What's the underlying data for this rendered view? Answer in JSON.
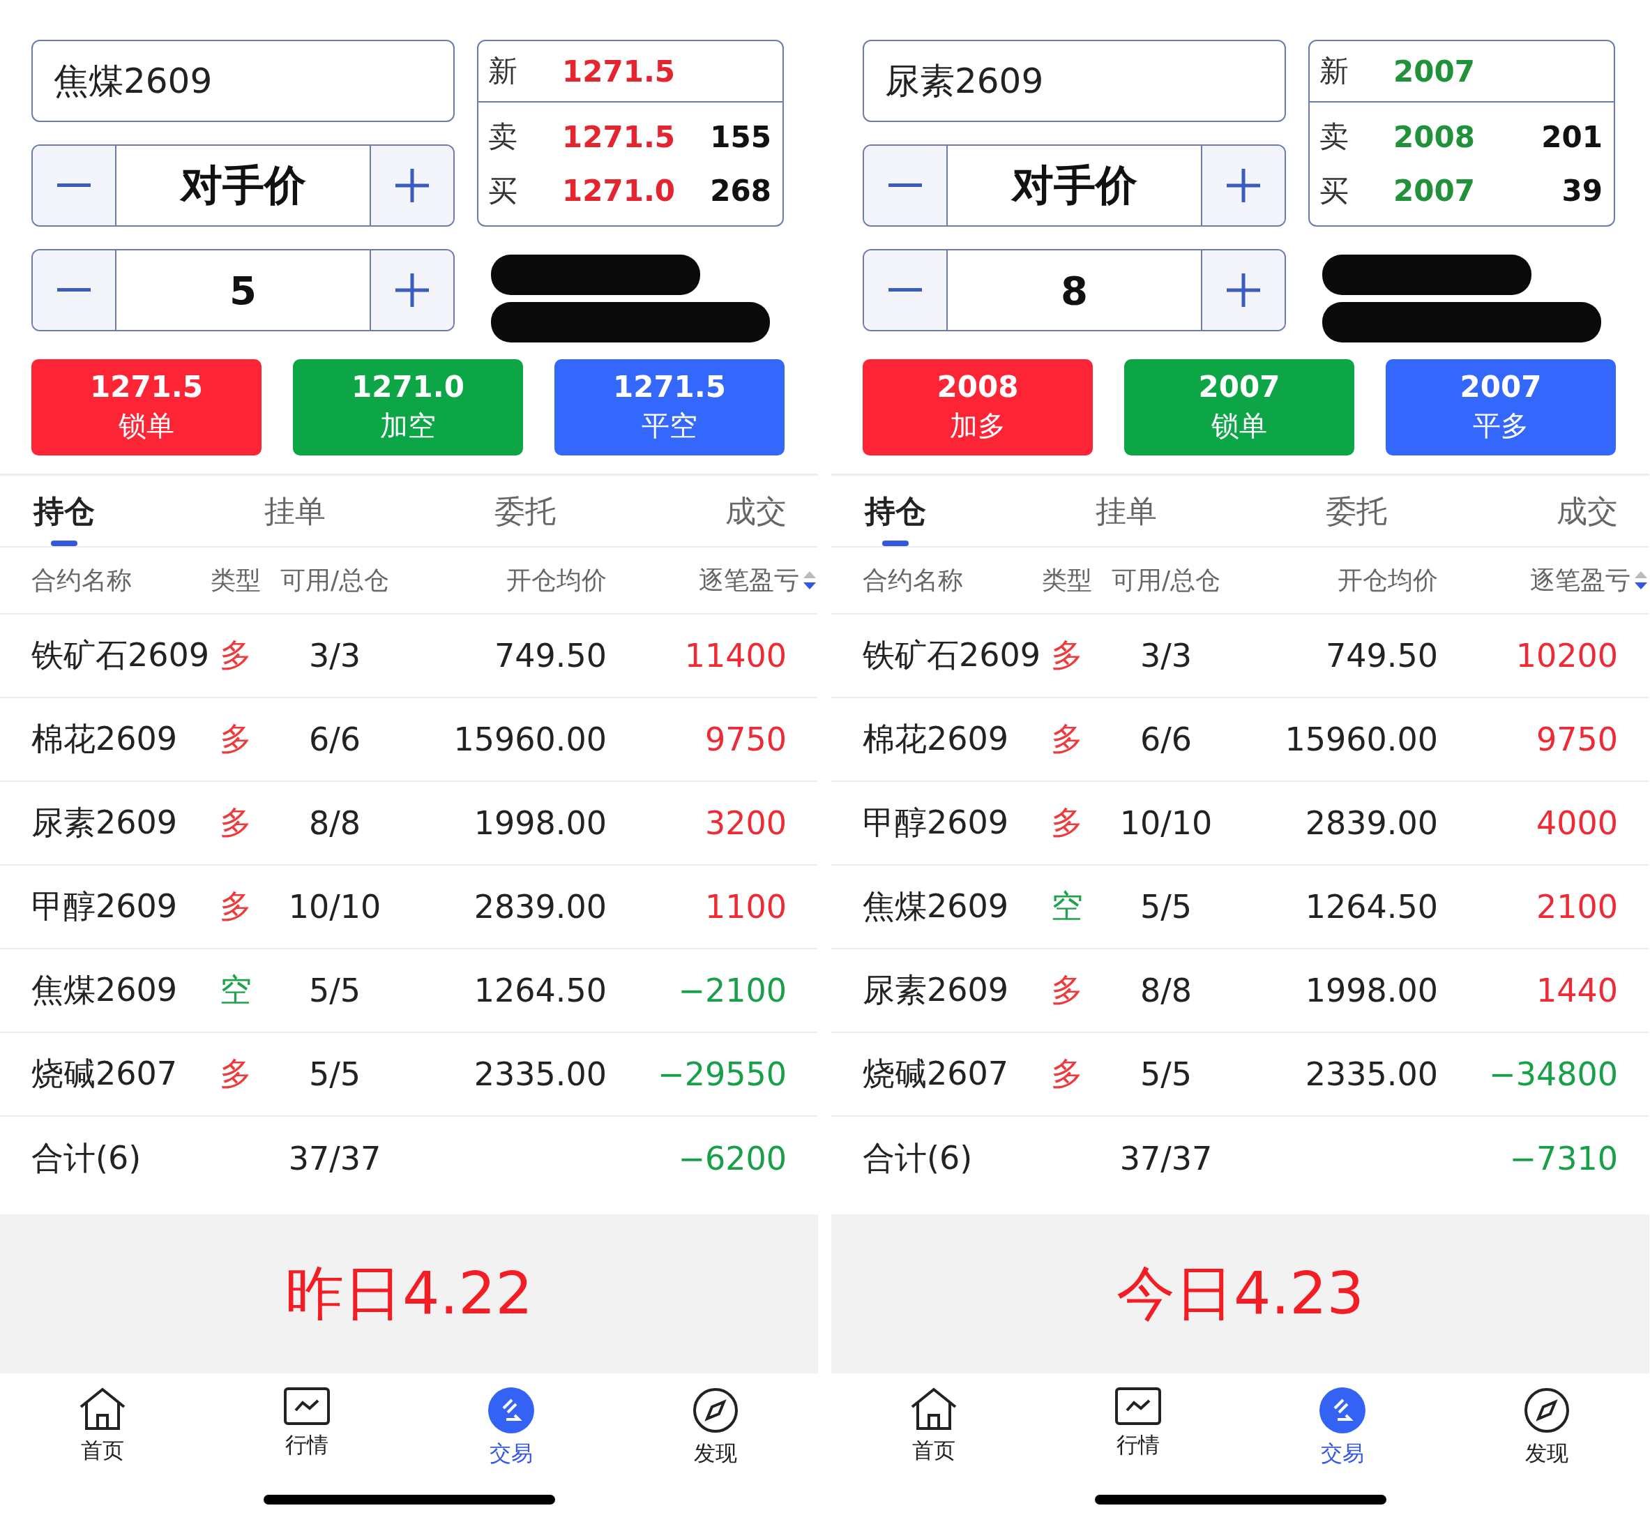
{
  "panels": [
    {
      "symbol": "焦煤2609",
      "quote": {
        "rows": [
          {
            "label": "新",
            "price": "1271.5"
          },
          {
            "label": "卖",
            "price": "1271.5",
            "volume": "155"
          },
          {
            "label": "买",
            "price": "1271.0",
            "volume": "268"
          }
        ],
        "color": "#e4252f"
      },
      "price_mode": "对手价",
      "quantity": "5",
      "actions": [
        {
          "price": "1271.5",
          "label": "锁单",
          "color": "#fd2436"
        },
        {
          "price": "1271.0",
          "label": "加空",
          "color": "#0ca647"
        },
        {
          "price": "1271.5",
          "label": "平空",
          "color": "#3467fb"
        }
      ],
      "tabs": [
        {
          "label": "持仓",
          "selected": true
        },
        {
          "label": "挂单",
          "selected": false
        },
        {
          "label": "委托",
          "selected": false
        },
        {
          "label": "成交",
          "selected": false
        }
      ],
      "columns": [
        "合约名称",
        "类型",
        "可用/总仓",
        "开仓均价",
        "逐笔盈亏"
      ],
      "rows": [
        {
          "name": "铁矿石2609",
          "direction": {
            "label": "多",
            "kind": "long"
          },
          "available": "3/3",
          "avg_price": "749.50",
          "pnl": {
            "value": "11400",
            "kind": "profit"
          }
        },
        {
          "name": "棉花2609",
          "direction": {
            "label": "多",
            "kind": "long"
          },
          "available": "6/6",
          "avg_price": "15960.00",
          "pnl": {
            "value": "9750",
            "kind": "profit"
          }
        },
        {
          "name": "尿素2609",
          "direction": {
            "label": "多",
            "kind": "long"
          },
          "available": "8/8",
          "avg_price": "1998.00",
          "pnl": {
            "value": "3200",
            "kind": "profit"
          }
        },
        {
          "name": "甲醇2609",
          "direction": {
            "label": "多",
            "kind": "long"
          },
          "available": "10/10",
          "avg_price": "2839.00",
          "pnl": {
            "value": "1100",
            "kind": "profit"
          }
        },
        {
          "name": "焦煤2609",
          "direction": {
            "label": "空",
            "kind": "short"
          },
          "available": "5/5",
          "avg_price": "1264.50",
          "pnl": {
            "value": "−2100",
            "kind": "loss"
          }
        },
        {
          "name": "烧碱2607",
          "direction": {
            "label": "多",
            "kind": "long"
          },
          "available": "5/5",
          "avg_price": "2335.00",
          "pnl": {
            "value": "−29550",
            "kind": "loss"
          }
        }
      ],
      "total": {
        "label": "合计(6)",
        "available": "37/37",
        "pnl": {
          "value": "−6200",
          "kind": "loss"
        }
      },
      "banner": "昨日4.22",
      "nav": [
        {
          "label": "首页",
          "kind": "home",
          "selected": false
        },
        {
          "label": "行情",
          "kind": "chart",
          "selected": false
        },
        {
          "label": "交易",
          "kind": "trade",
          "selected": true
        },
        {
          "label": "发现",
          "kind": "compass",
          "selected": false
        }
      ]
    },
    {
      "symbol": "尿素2609",
      "quote": {
        "rows": [
          {
            "label": "新",
            "price": "2007"
          },
          {
            "label": "卖",
            "price": "2008",
            "volume": "201"
          },
          {
            "label": "买",
            "price": "2007",
            "volume": "39"
          }
        ],
        "color": "#21913b"
      },
      "price_mode": "对手价",
      "quantity": "8",
      "actions": [
        {
          "price": "2008",
          "label": "加多",
          "color": "#fd2436"
        },
        {
          "price": "2007",
          "label": "锁单",
          "color": "#0ca647"
        },
        {
          "price": "2007",
          "label": "平多",
          "color": "#3467fb"
        }
      ],
      "tabs": [
        {
          "label": "持仓",
          "selected": true
        },
        {
          "label": "挂单",
          "selected": false
        },
        {
          "label": "委托",
          "selected": false
        },
        {
          "label": "成交",
          "selected": false
        }
      ],
      "columns": [
        "合约名称",
        "类型",
        "可用/总仓",
        "开仓均价",
        "逐笔盈亏"
      ],
      "rows": [
        {
          "name": "铁矿石2609",
          "direction": {
            "label": "多",
            "kind": "long"
          },
          "available": "3/3",
          "avg_price": "749.50",
          "pnl": {
            "value": "10200",
            "kind": "profit"
          }
        },
        {
          "name": "棉花2609",
          "direction": {
            "label": "多",
            "kind": "long"
          },
          "available": "6/6",
          "avg_price": "15960.00",
          "pnl": {
            "value": "9750",
            "kind": "profit"
          }
        },
        {
          "name": "甲醇2609",
          "direction": {
            "label": "多",
            "kind": "long"
          },
          "available": "10/10",
          "avg_price": "2839.00",
          "pnl": {
            "value": "4000",
            "kind": "profit"
          }
        },
        {
          "name": "焦煤2609",
          "direction": {
            "label": "空",
            "kind": "short"
          },
          "available": "5/5",
          "avg_price": "1264.50",
          "pnl": {
            "value": "2100",
            "kind": "profit"
          }
        },
        {
          "name": "尿素2609",
          "direction": {
            "label": "多",
            "kind": "long"
          },
          "available": "8/8",
          "avg_price": "1998.00",
          "pnl": {
            "value": "1440",
            "kind": "profit"
          }
        },
        {
          "name": "烧碱2607",
          "direction": {
            "label": "多",
            "kind": "long"
          },
          "available": "5/5",
          "avg_price": "2335.00",
          "pnl": {
            "value": "−34800",
            "kind": "loss"
          }
        }
      ],
      "total": {
        "label": "合计(6)",
        "available": "37/37",
        "pnl": {
          "value": "−7310",
          "kind": "loss"
        }
      },
      "banner": "今日4.23",
      "nav": [
        {
          "label": "首页",
          "kind": "home",
          "selected": false
        },
        {
          "label": "行情",
          "kind": "chart",
          "selected": false
        },
        {
          "label": "交易",
          "kind": "trade",
          "selected": true
        },
        {
          "label": "发现",
          "kind": "compass",
          "selected": false
        }
      ]
    }
  ]
}
